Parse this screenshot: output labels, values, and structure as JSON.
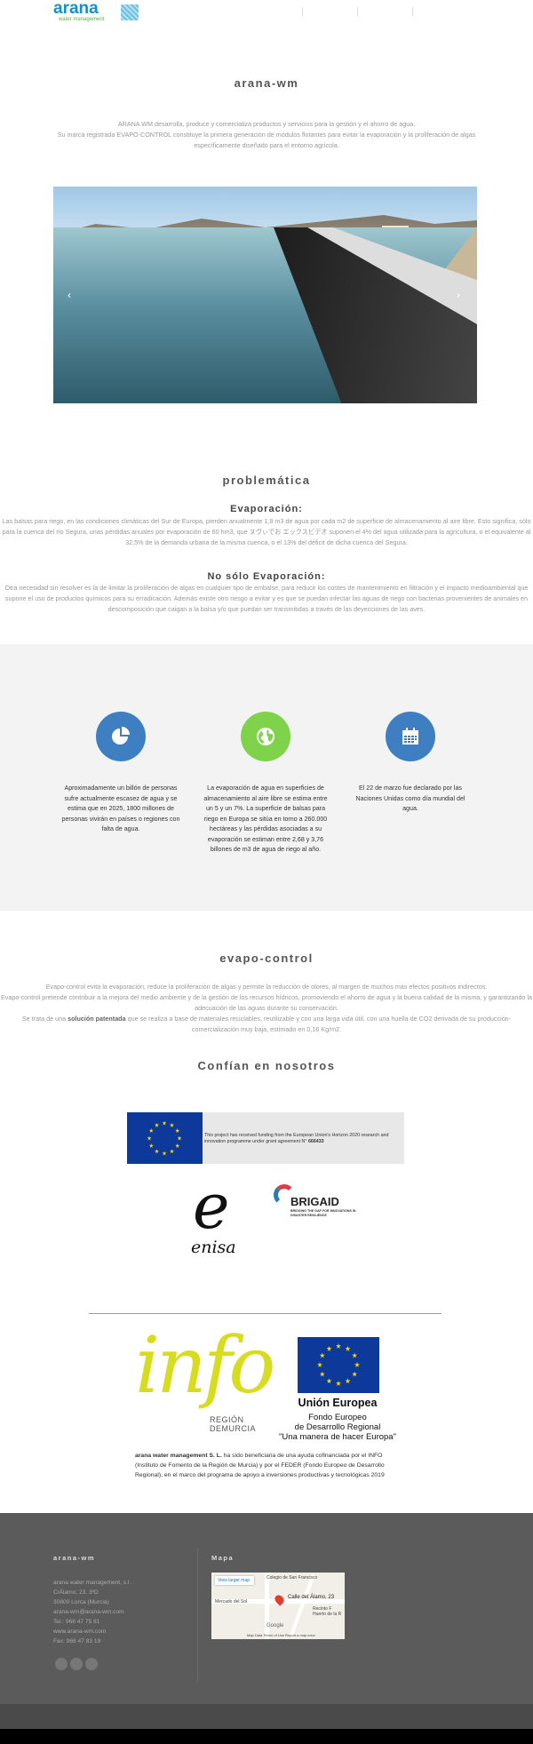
{
  "header": {
    "logo_word": "arana",
    "logo_sub": "water management",
    "nav": [
      "",
      "",
      ""
    ]
  },
  "intro": {
    "title": "arana-wm",
    "line1": "ARANA WM desarrolla, produce y comercializa productos y servicios para la gestión y el ahorro de agua.",
    "line2": "Su marca registrada EVAPO-CONTROL constituye la primera generación de módulos flotantes para evitar la evaporación y la proliferación de algas",
    "line3": "específicamente diseñado para el entorno agrícola."
  },
  "slider": {
    "prev": "‹",
    "next": "›"
  },
  "problematica": {
    "title": "problemática",
    "evap_title": "Evaporación:",
    "evap_text": "Las balsas para riego, en las condiciones climáticas del Sur de Europa, pierden anualmente 1,8 m3 de agua por cada m2 de superficie de almacenamiento al aire libre. Esto significa, sólo para la cuenca del río Segura, unas pérdidas anuales por evaporación de 60 hm3, que ヌヴぃでお エックスビデオ suponen el 4% del agua utilizada para la agricultura, o el equivalente al 32,5% de la demanda urbana de la misma cuenca, o el 13% del déficit de dicha cuenca del Segura.",
    "no_solo_title": "No sólo Evaporación:",
    "no_solo_text": "Otra necesidad sin resolver es la de limitar la proliferación de algas en cualquier tipo de embalse, para reducir los costes de mantenimiento en filtración y el impacto medioambiental que supone el uso de productos químicos para su erradicación. Además existe otro riesgo a evitar y es que se puedan infectar las aguas de riego con bacterias provenientes de animales en descomposición que caigan a la balsa y/o que puedan ser transmitidas a través de las deyecciones de las aves."
  },
  "features": [
    {
      "icon": "pie-chart-icon",
      "color": "#3d7fc1",
      "text": "Aproximadamente un billón de personas sufre actualmente escasez de agua y se estima que en 2025, 1800 millones de personas vivirán en países o regiones con falta de agua."
    },
    {
      "icon": "globe-icon",
      "color": "#7ed34a",
      "text": "La evaporación de agua en superficies de almacenamiento al aire libre se estima entre un 5 y un 7%. La superficie de balsas para riego en Europa se sitúa en torno a 260.000 hectáreas y las pérdidas asociadas a su evaporación se estiman entre 2,68 y 3,76 billones de m3 de agua de riego al año."
    },
    {
      "icon": "calendar-icon",
      "color": "#3d7fc1",
      "text": "El 22 de marzo fue declarado por las Naciones Unidas como día mundial del agua."
    }
  ],
  "evapo": {
    "title": "evapo-control",
    "line1": "Evapo-control evita la evaporación, reduce la proliferación de algas y permite la reducción de olores, al margen de muchos más efectos positivos indirectos.",
    "line2": "Evapo-control pretende contribuir a la mejora del medio ambiente y de la gestión de los recursos hídricos, promoviendo el ahorro de agua y la buena calidad de la misma, y  garantizando la adecuación de las aguas durante su conservación.",
    "line3_pre": "Se  trata de una ",
    "line3_bold": "solución patentada",
    "line3_post": "  que se realiza a base de materiales reciclables, reutilizable y con una larga vida útil, con una huella de CO2 derivada de su producción-comercialización muy baja, estimado en 0,16 Kg/m2."
  },
  "confian": {
    "title": "Confían en nosotros",
    "eu_text_1": "This project has received funding from the European Union's Horizon 2020 research and innovation programme under grant agreement N° ",
    "eu_grant": "666433",
    "enisa_letter": "e",
    "enisa_name": "enisa",
    "brigaid_name": "BRIGAID",
    "brigaid_tag": "BRIDGING THE GAP FOR INNOVATIONS IN DISASTER RESILIENCE"
  },
  "funding": {
    "info_word": "info",
    "region_1": "REGIÓN",
    "region_2": "DEMURCIA",
    "ue_title": "Unión Europea",
    "ue_fondo_1": "Fondo Europeo",
    "ue_fondo_2": "de Desarrollo Regional",
    "ue_slogan": "\"Una manera de hacer Europa\"",
    "text_bold": "arana water management S. L.",
    "text": " ha sido beneficiaria de una ayuda cofinanciada por el INFO (Instituto de Fomento de la Región de Murcia) y por el FEDER (Fondo Europeo de Desarrollo Regional), en el marco del programa de apoyo a inversiones productivas y tecnológicas 2019"
  },
  "footer": {
    "col1_title": "arana-wm",
    "lines": [
      "arana water management, s.l.",
      "C/Álamo, 23, 3ºD",
      "30800 Lorca (Murcia)",
      "arana-wm@arana-wm.com",
      "Tel.: 968 47 75 81",
      "www.arana-wm.com",
      "Fax: 968 47 83 19"
    ],
    "col2_title": "Mapa",
    "map_link": "View larger map",
    "map_street": "Calle del Álamo, 23",
    "map_colegio": "Colegio de San Francisco",
    "map_mercado": "Mercado del Sol",
    "map_recinto": "Recinto F Huerto de la R",
    "map_footer": "Map Data   Terms of Use   Report a map error",
    "map_google": "Google"
  }
}
